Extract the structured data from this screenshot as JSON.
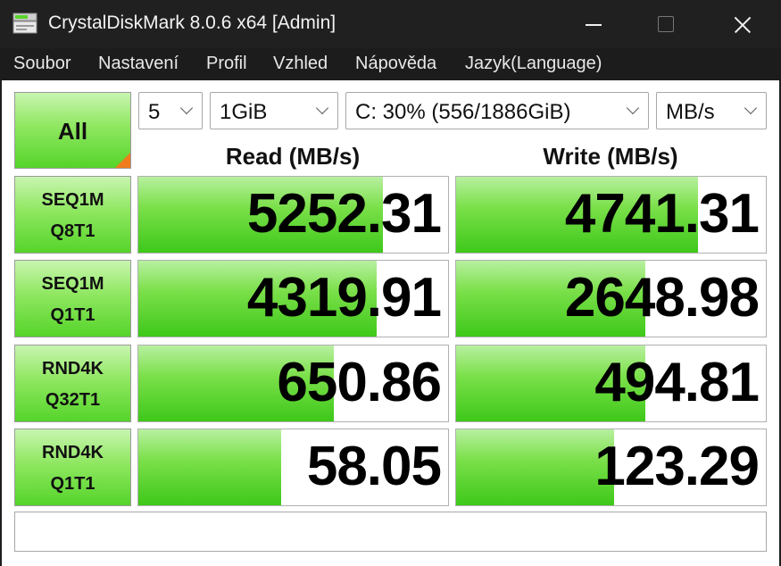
{
  "window": {
    "title": "CrystalDiskMark 8.0.6 x64 [Admin]"
  },
  "menu": [
    "Soubor",
    "Nastavení",
    "Profil",
    "Vzhled",
    "Nápověda",
    "Jazyk(Language)"
  ],
  "controls": {
    "all_label": "All",
    "count": "5",
    "size": "1GiB",
    "drive": "C: 30% (556/1886GiB)",
    "unit": "MB/s"
  },
  "headers": {
    "read": "Read (MB/s)",
    "write": "Write (MB/s)"
  },
  "tests": [
    {
      "line1": "SEQ1M",
      "line2": "Q8T1",
      "read": "5252.31",
      "write": "4741.31",
      "read_fill": 0.79,
      "write_fill": 0.78
    },
    {
      "line1": "SEQ1M",
      "line2": "Q1T1",
      "read": "4319.91",
      "write": "2648.98",
      "read_fill": 0.77,
      "write_fill": 0.61
    },
    {
      "line1": "RND4K",
      "line2": "Q32T1",
      "read": "650.86",
      "write": "494.81",
      "read_fill": 0.63,
      "write_fill": 0.61
    },
    {
      "line1": "RND4K",
      "line2": "Q1T1",
      "read": "58.05",
      "write": "123.29",
      "read_fill": 0.46,
      "write_fill": 0.51
    }
  ],
  "comment": "",
  "colors": {
    "bar_green": "#5ad42a",
    "button_green": "#8fe760",
    "corner_orange": "#f07c1c",
    "titlebar": "#202020"
  },
  "icons": {
    "app": "disk-icon",
    "minimize": "minimize-icon",
    "maximize": "maximize-icon",
    "close": "close-icon",
    "dropdown": "chevron-down-icon"
  }
}
